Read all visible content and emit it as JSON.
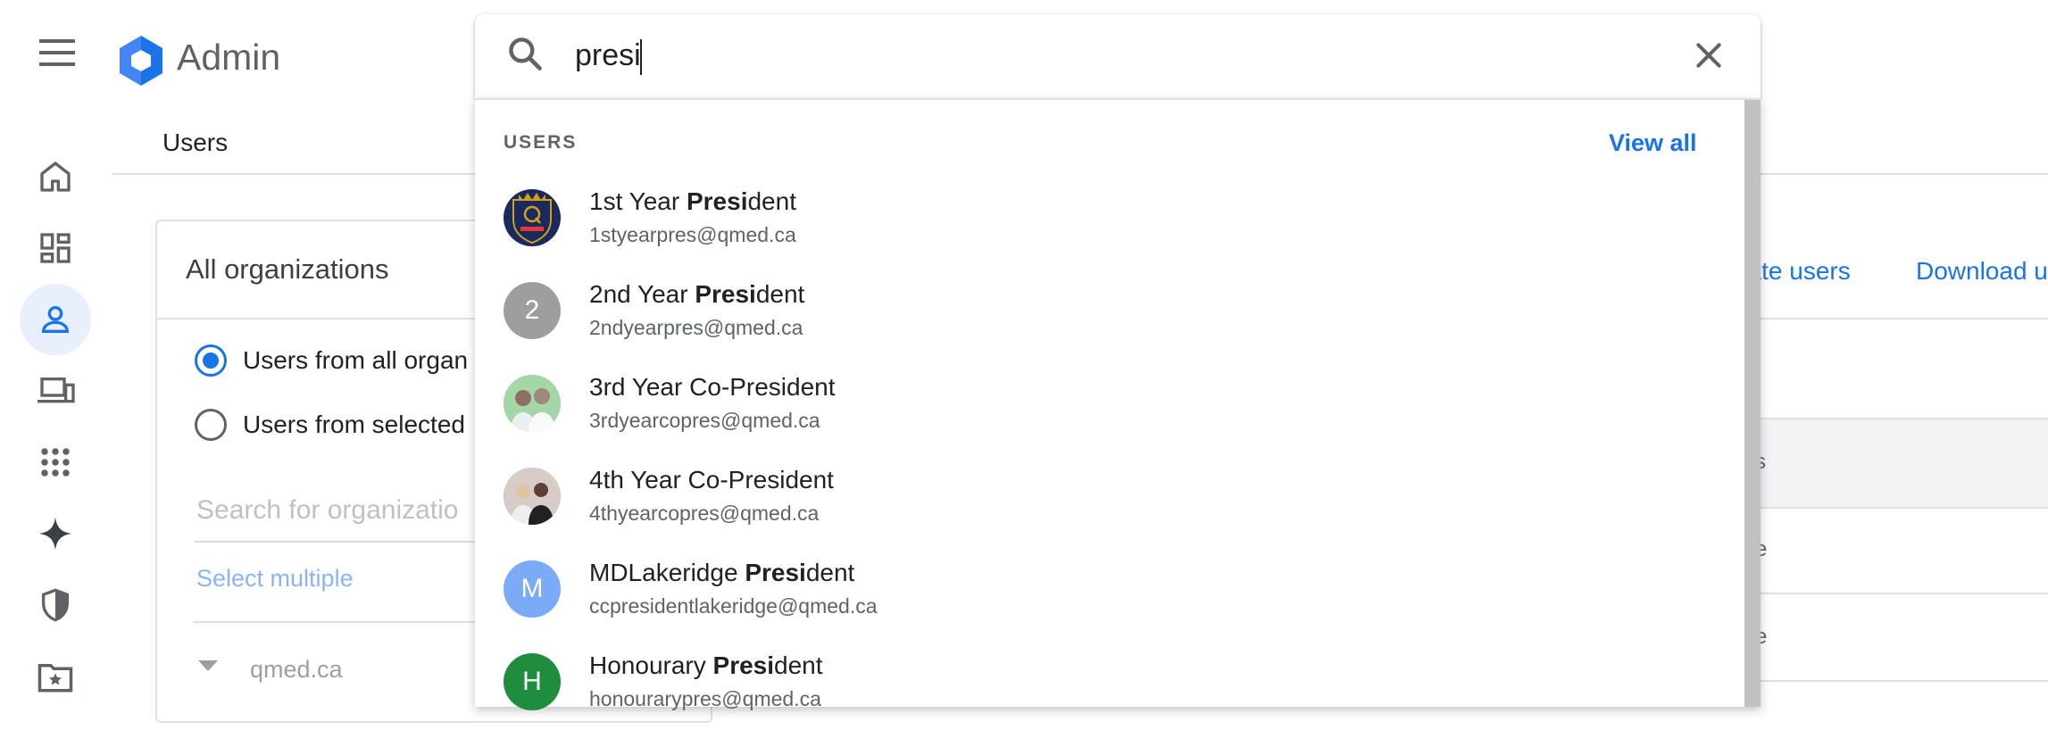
{
  "app": {
    "title": "Admin"
  },
  "tabs": {
    "users": "Users"
  },
  "org_panel": {
    "title": "All organizations",
    "radio_all": "Users from all organ",
    "radio_selected": "Users from selected",
    "search_placeholder": "Search for organizatio",
    "select_multiple": "Select multiple",
    "tree_root": "qmed.ca"
  },
  "right_panel": {
    "action_update": "date users",
    "action_download": "Download u",
    "col_fragment": "s",
    "row1_fragment": "e",
    "row2_fragment": "e"
  },
  "search": {
    "query": "presi",
    "section_label": "USERS",
    "view_all": "View all",
    "results": [
      {
        "name_pre": "1st Year ",
        "name_match": "Presi",
        "name_post": "dent",
        "email": "1styearpres@qmed.ca",
        "avatar_type": "crest",
        "avatar_color": "#1b2a5e"
      },
      {
        "name_pre": "2nd Year ",
        "name_match": "Presi",
        "name_post": "dent",
        "email": "2ndyearpres@qmed.ca",
        "avatar_type": "letter",
        "avatar_letter": "2",
        "avatar_color": "#9e9e9e"
      },
      {
        "name_pre": "3rd Year Co-President",
        "name_match": "",
        "name_post": "",
        "email": "3rdyearcopres@qmed.ca",
        "avatar_type": "photo",
        "avatar_color": "#8d6e63"
      },
      {
        "name_pre": "4th Year Co-President",
        "name_match": "",
        "name_post": "",
        "email": "4thyearcopres@qmed.ca",
        "avatar_type": "photo",
        "avatar_color": "#6d5a4b"
      },
      {
        "name_pre": "MDLakeridge ",
        "name_match": "Presi",
        "name_post": "dent",
        "email": "ccpresidentlakeridge@qmed.ca",
        "avatar_type": "letter",
        "avatar_letter": "M",
        "avatar_color": "#7baaf7"
      },
      {
        "name_pre": "Honourary ",
        "name_match": "Presi",
        "name_post": "dent",
        "email": "honourarypres@qmed.ca",
        "avatar_type": "letter",
        "avatar_letter": "H",
        "avatar_color": "#1e8e3e"
      }
    ]
  },
  "colors": {
    "accent": "#1a73e8",
    "text": "#202124",
    "muted": "#5f6368"
  },
  "icons": {
    "rail": [
      "home-icon",
      "dashboard-icon",
      "person-icon",
      "devices-icon",
      "apps-icon",
      "sparkle-icon",
      "shield-icon",
      "folder-star-icon"
    ]
  }
}
